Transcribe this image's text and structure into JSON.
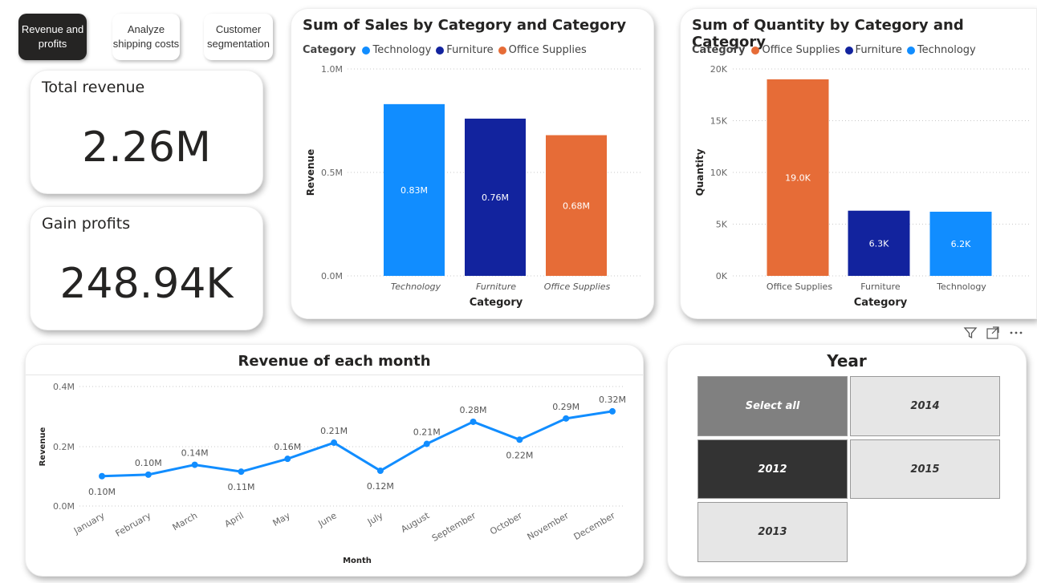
{
  "nav": {
    "tabs": [
      {
        "label": "Revenue and profits",
        "active": true
      },
      {
        "label": "Analyze shipping costs",
        "active": false
      },
      {
        "label": "Customer segmentation",
        "active": false
      }
    ]
  },
  "kpis": {
    "total_revenue": {
      "label": "Total revenue",
      "value": "2.26M"
    },
    "gain_profits": {
      "label": "Gain profits",
      "value": "248.94K"
    }
  },
  "sales_chart": {
    "title": "Sum of Sales by Category and Category",
    "legend_label": "Category",
    "legend": [
      "Technology",
      "Furniture",
      "Office Supplies"
    ],
    "y_ticks": [
      "1.0M",
      "0.5M",
      "0.0M"
    ],
    "xlabel": "Category",
    "ylabel": "Revenue",
    "data_labels": [
      "0.83M",
      "0.76M",
      "0.68M"
    ]
  },
  "quantity_chart": {
    "title": "Sum of Quantity by Category and Category",
    "legend_label": "Category",
    "legend": [
      "Office Supplies",
      "Furniture",
      "Technology"
    ],
    "y_ticks": [
      "20K",
      "15K",
      "10K",
      "5K",
      "0K"
    ],
    "xlabel": "Category",
    "ylabel": "Quantity",
    "data_labels": [
      "19.0K",
      "6.3K",
      "6.2K"
    ]
  },
  "monthly_chart": {
    "title": "Revenue of each month",
    "xlabel": "Month",
    "ylabel": "Revenue",
    "y_ticks": [
      "0.4M",
      "0.2M",
      "0.0M"
    ],
    "data_labels": [
      "0.10M",
      "0.10M",
      "0.14M",
      "0.11M",
      "0.16M",
      "0.21M",
      "0.12M",
      "0.21M",
      "0.28M",
      "0.22M",
      "0.29M",
      "0.32M"
    ]
  },
  "year_slicer": {
    "title": "Year",
    "options": [
      {
        "label": "Select all",
        "state": "partial"
      },
      {
        "label": "2014",
        "state": "off"
      },
      {
        "label": "2012",
        "state": "on"
      },
      {
        "label": "2015",
        "state": "off"
      },
      {
        "label": "2013",
        "state": "off"
      }
    ]
  },
  "colors": {
    "technology": "#118DFF",
    "furniture": "#12239E",
    "office_supplies": "#E66C37",
    "line": "#118DFF",
    "tab_active": "#252423",
    "slicer_on": "#333333",
    "slicer_partial": "#808080",
    "slicer_off": "#E6E6E6"
  },
  "chart_data": [
    {
      "type": "bar",
      "title": "Sum of Sales by Category and Category",
      "xlabel": "Category",
      "ylabel": "Revenue",
      "categories": [
        "Technology",
        "Furniture",
        "Office Supplies"
      ],
      "values": [
        830000,
        760000,
        680000
      ],
      "ylim": [
        0,
        1000000
      ],
      "colors": [
        "#118DFF",
        "#12239E",
        "#E66C37"
      ],
      "legend": "top-left",
      "grid": true
    },
    {
      "type": "bar",
      "title": "Sum of Quantity by Category and Category",
      "xlabel": "Category",
      "ylabel": "Quantity",
      "categories": [
        "Office Supplies",
        "Furniture",
        "Technology"
      ],
      "values": [
        19000,
        6300,
        6200
      ],
      "ylim": [
        0,
        20000
      ],
      "colors": [
        "#E66C37",
        "#12239E",
        "#118DFF"
      ],
      "legend": "top-left",
      "grid": true
    },
    {
      "type": "line",
      "title": "Revenue of each month",
      "xlabel": "Month",
      "ylabel": "Revenue",
      "categories": [
        "January",
        "February",
        "March",
        "April",
        "May",
        "June",
        "July",
        "August",
        "September",
        "October",
        "November",
        "December"
      ],
      "values": [
        100000,
        105000,
        138000,
        115000,
        158000,
        212000,
        118000,
        208000,
        282000,
        222000,
        293000,
        317000
      ],
      "ylim": [
        0,
        400000
      ],
      "grid": true
    }
  ]
}
